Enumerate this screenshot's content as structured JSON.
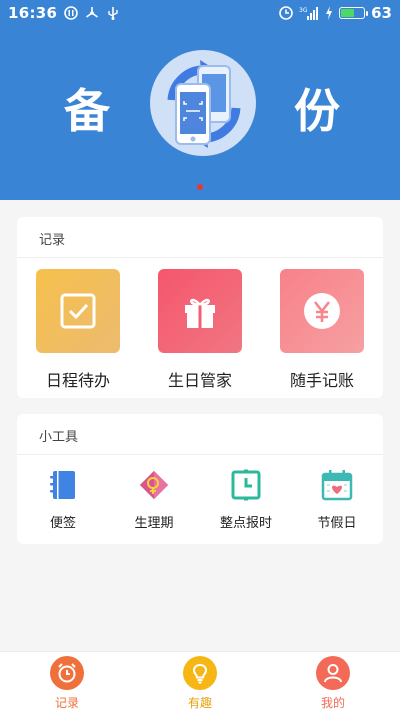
{
  "status_bar": {
    "time": "16:36",
    "battery_percent": "63",
    "battery_level": 0.63,
    "network": "3G"
  },
  "banner": {
    "left_text": "备",
    "right_text": "份",
    "page_indicator_active": 1
  },
  "record_section": {
    "title": "记录",
    "items": [
      {
        "label": "日程待办",
        "icon": "checkbox-icon",
        "color": "#f1b646"
      },
      {
        "label": "生日管家",
        "icon": "gift-icon",
        "color": "#f25a6e"
      },
      {
        "label": "随手记账",
        "icon": "yuan-icon",
        "color": "#f7868b"
      }
    ]
  },
  "tools_section": {
    "title": "小工具",
    "items": [
      {
        "label": "便签",
        "icon": "notebook-icon"
      },
      {
        "label": "生理期",
        "icon": "period-icon"
      },
      {
        "label": "整点报时",
        "icon": "clock-icon"
      },
      {
        "label": "节假日",
        "icon": "calendar-icon"
      }
    ]
  },
  "bottom_nav": {
    "items": [
      {
        "label": "记录",
        "icon": "alarm-clock-icon",
        "color": "#f0703c"
      },
      {
        "label": "有趣",
        "icon": "lightbulb-icon",
        "color": "#f5b616"
      },
      {
        "label": "我的",
        "icon": "user-icon",
        "color": "#f36a57"
      }
    ]
  }
}
